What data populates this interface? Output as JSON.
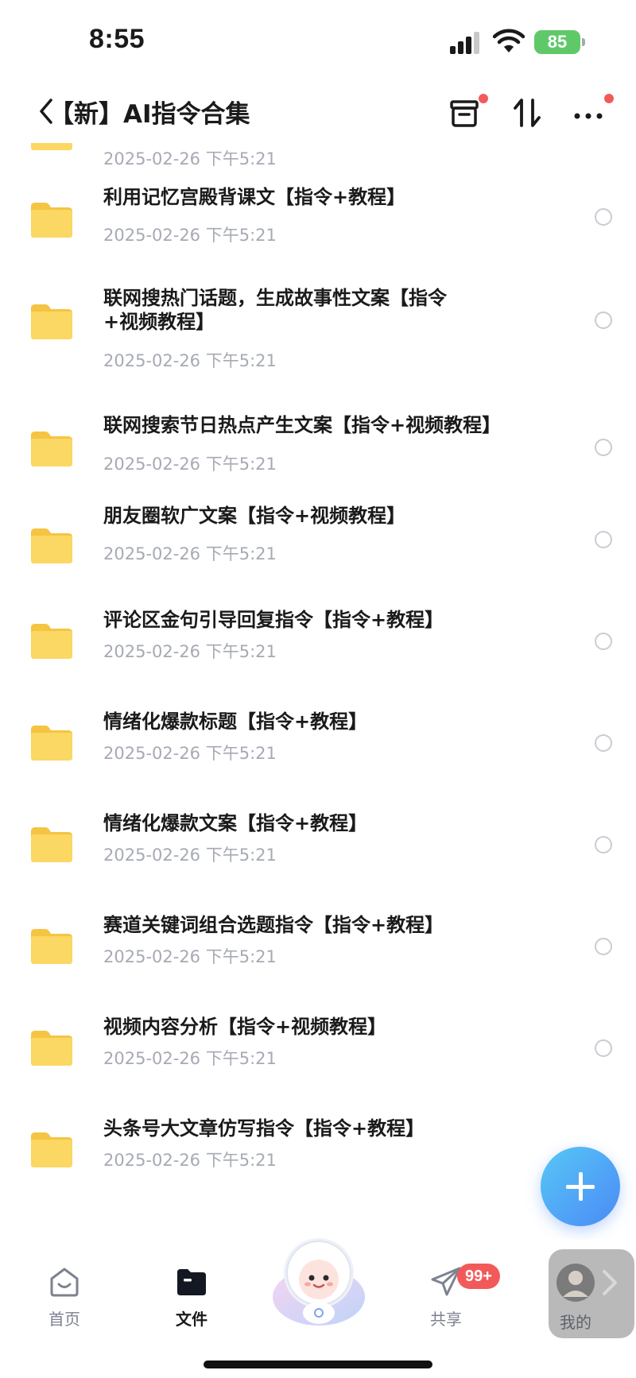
{
  "status_bar": {
    "time": "8:55",
    "battery": "85"
  },
  "header": {
    "title": "【新】AI指令合集",
    "icons": [
      "back-icon",
      "recycle-box-icon",
      "sort-icon",
      "more-icon"
    ],
    "dot_color": "#f25a5a"
  },
  "files": [
    {
      "name": "",
      "date": "2025-02-26 下午5:21"
    },
    {
      "name": "利用记忆宫殿背课文【指令+教程】",
      "date": "2025-02-26 下午5:21"
    },
    {
      "name": "联网搜热门话题，生成故事性文案【指令+视频教程】",
      "date": "2025-02-26 下午5:21"
    },
    {
      "name": "联网搜索节日热点产生文案【指令+视频教程】",
      "date": "2025-02-26 下午5:21"
    },
    {
      "name": "朋友圈软广文案【指令+视频教程】",
      "date": "2025-02-26 下午5:21"
    },
    {
      "name": "评论区金句引导回复指令【指令+教程】",
      "date": "2025-02-26 下午5:21"
    },
    {
      "name": "情绪化爆款标题【指令+教程】",
      "date": "2025-02-26 下午5:21"
    },
    {
      "name": "情绪化爆款文案【指令+教程】",
      "date": "2025-02-26 下午5:21"
    },
    {
      "name": "赛道关键词组合选题指令【指令+教程】",
      "date": "2025-02-26 下午5:21"
    },
    {
      "name": "视频内容分析【指令+视频教程】",
      "date": "2025-02-26 下午5:21"
    },
    {
      "name": "头条号大文章仿写指令【指令+教程】",
      "date": "2025-02-26 下午5:21"
    }
  ],
  "fab": {
    "icon": "plus-icon"
  },
  "tab_bar": {
    "home": "首页",
    "files": "文件",
    "share": "共享",
    "share_badge": "99+",
    "mine": "我的"
  },
  "colors": {
    "accent": "#4b8af5",
    "folder": "#f7cf55",
    "date_text": "#a6aab4",
    "badge": "#f25a5a"
  }
}
